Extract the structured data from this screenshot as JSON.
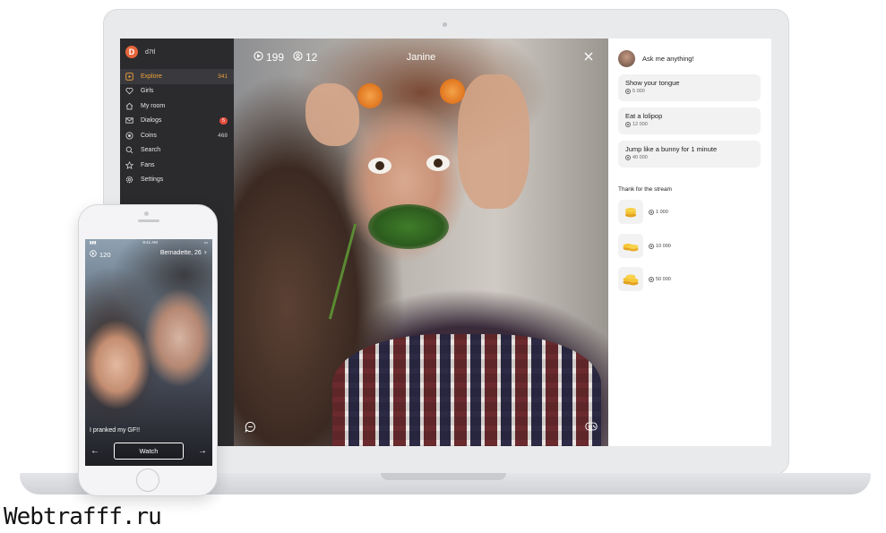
{
  "sidebar": {
    "user": {
      "initial": "D",
      "name": "d7tl"
    },
    "items": [
      {
        "label": "Explore",
        "count": "341",
        "icon": "play-square-icon",
        "active": true
      },
      {
        "label": "Girls",
        "count": "",
        "icon": "heart-icon"
      },
      {
        "label": "My room",
        "count": "",
        "icon": "home-icon"
      },
      {
        "label": "Dialogs",
        "count": "",
        "badge": "5",
        "icon": "mail-icon"
      },
      {
        "label": "Coins",
        "count": "468",
        "icon": "coin-icon"
      },
      {
        "label": "Search",
        "count": "",
        "icon": "search-icon"
      },
      {
        "label": "Fans",
        "count": "",
        "icon": "star-icon"
      },
      {
        "label": "Settings",
        "count": "",
        "icon": "gear-icon"
      }
    ]
  },
  "video": {
    "viewers": "199",
    "fans": "12",
    "title": "Janine"
  },
  "panel": {
    "ask_title": "Ask me anything!",
    "requests": [
      {
        "label": "Show your tongue",
        "price": "5 000"
      },
      {
        "label": "Eat a lolipop",
        "price": "12 000"
      },
      {
        "label": "Jump like a bunny for 1 minute",
        "price": "40 000"
      }
    ],
    "thank_title": "Thank for the stream",
    "gifts": [
      {
        "price": "1 000"
      },
      {
        "price": "10 000"
      },
      {
        "price": "50 000"
      }
    ]
  },
  "phone": {
    "time": "9:41 AM",
    "viewers": "120",
    "name": "Bernadette, 26 ♀",
    "caption": "I pranked my GF!!",
    "watch_label": "Watch"
  },
  "watermark": "Webtrafff.ru",
  "colors": {
    "accent": "#f0a23b",
    "badge": "#e04b3c",
    "sidebar": "#2b2b2e"
  }
}
